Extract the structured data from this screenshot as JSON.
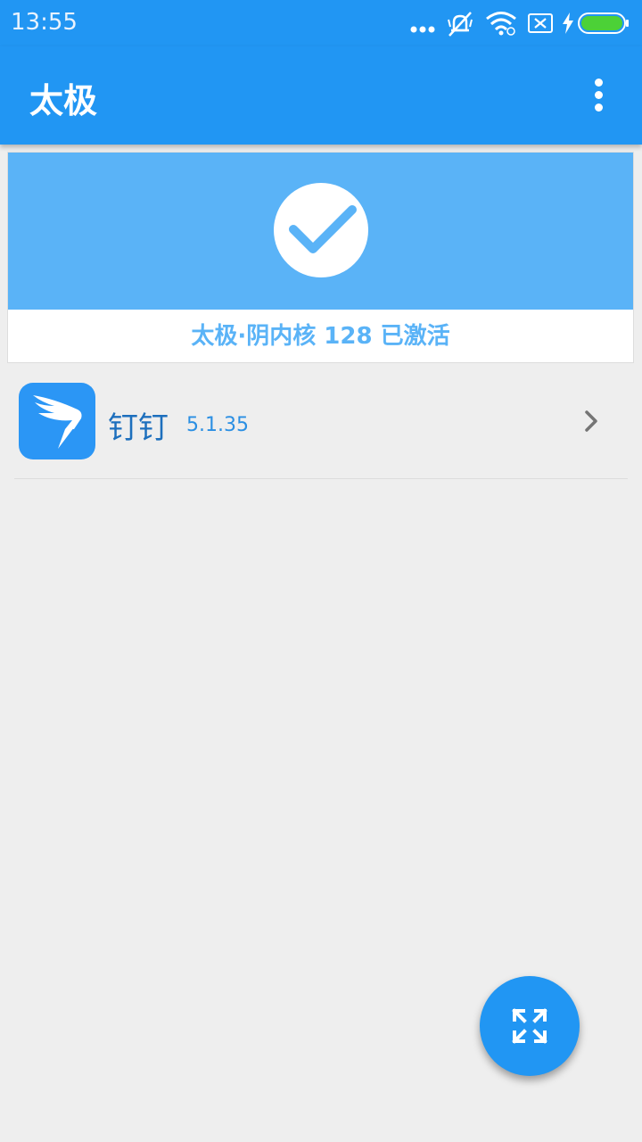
{
  "status_bar": {
    "time": "13:55",
    "icons": [
      "more-dots-icon",
      "mute-icon",
      "wifi-icon",
      "no-sim-icon",
      "charging-bolt-icon",
      "battery-icon"
    ]
  },
  "app_bar": {
    "title": "太极",
    "menu_icon": "overflow-menu-icon"
  },
  "status_card": {
    "icon": "check-icon",
    "text": "太极·阴内核 128 已激活",
    "banner_color": "#5ab3f7"
  },
  "apps": [
    {
      "name": "钉钉",
      "version": "5.1.35",
      "icon": "dingtalk-icon",
      "chevron": "chevron-right-icon"
    }
  ],
  "fab": {
    "icon": "expand-arrows-icon"
  },
  "colors": {
    "primary": "#2196f3",
    "accent_light": "#5ab3f7",
    "background": "#eeeeee"
  }
}
